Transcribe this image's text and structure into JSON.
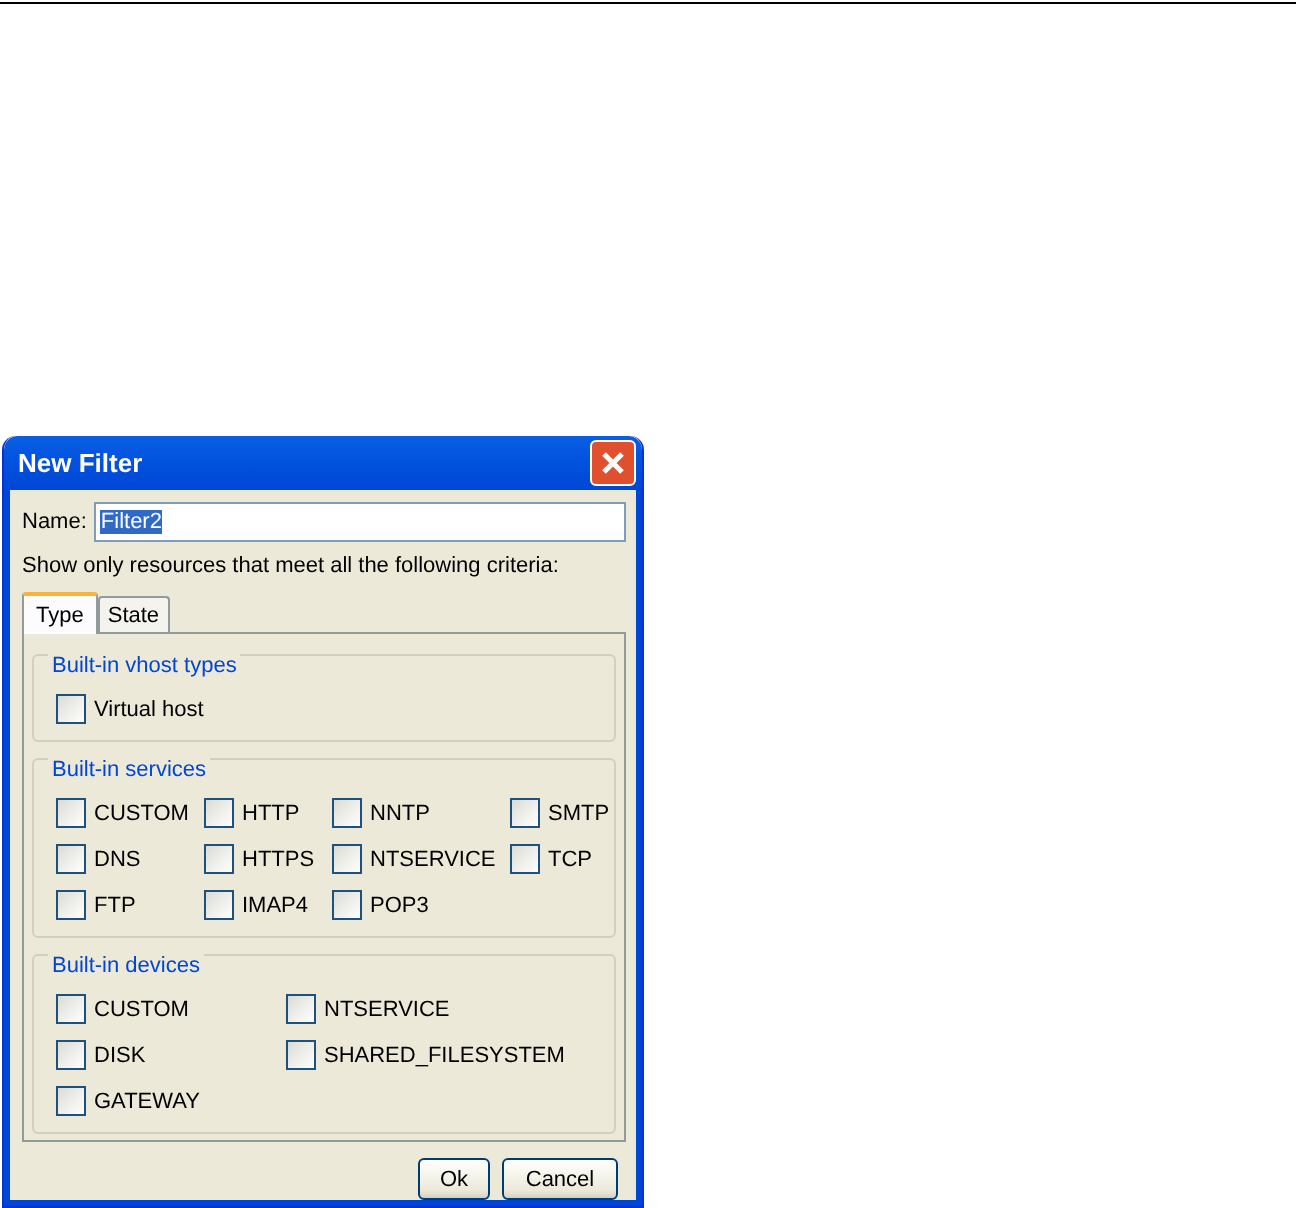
{
  "window": {
    "title": "New Filter"
  },
  "name_field": {
    "label": "Name:",
    "value": "Filter2"
  },
  "description": "Show only resources that meet all the following criteria:",
  "tabs": [
    {
      "label": "Type",
      "selected": true
    },
    {
      "label": "State",
      "selected": false
    }
  ],
  "groups": [
    {
      "title": "Built-in vhost types",
      "columns": [
        [
          {
            "label": "Virtual host",
            "checked": false
          }
        ]
      ]
    },
    {
      "title": "Built-in services",
      "columns": [
        [
          {
            "label": "CUSTOM",
            "checked": false
          },
          {
            "label": "DNS",
            "checked": false
          },
          {
            "label": "FTP",
            "checked": false
          }
        ],
        [
          {
            "label": "HTTP",
            "checked": false
          },
          {
            "label": "HTTPS",
            "checked": false
          },
          {
            "label": "IMAP4",
            "checked": false
          }
        ],
        [
          {
            "label": "NNTP",
            "checked": false
          },
          {
            "label": "NTSERVICE",
            "checked": false
          },
          {
            "label": "POP3",
            "checked": false
          }
        ],
        [
          {
            "label": "SMTP",
            "checked": false
          },
          {
            "label": "TCP",
            "checked": false
          }
        ]
      ]
    },
    {
      "title": "Built-in devices",
      "columns": [
        [
          {
            "label": "CUSTOM",
            "checked": false
          },
          {
            "label": "DISK",
            "checked": false
          },
          {
            "label": "GATEWAY",
            "checked": false
          }
        ],
        [
          {
            "label": "NTSERVICE",
            "checked": false
          },
          {
            "label": "SHARED_FILESYSTEM",
            "checked": false
          }
        ]
      ]
    }
  ],
  "buttons": [
    "Ok",
    "Cancel"
  ]
}
